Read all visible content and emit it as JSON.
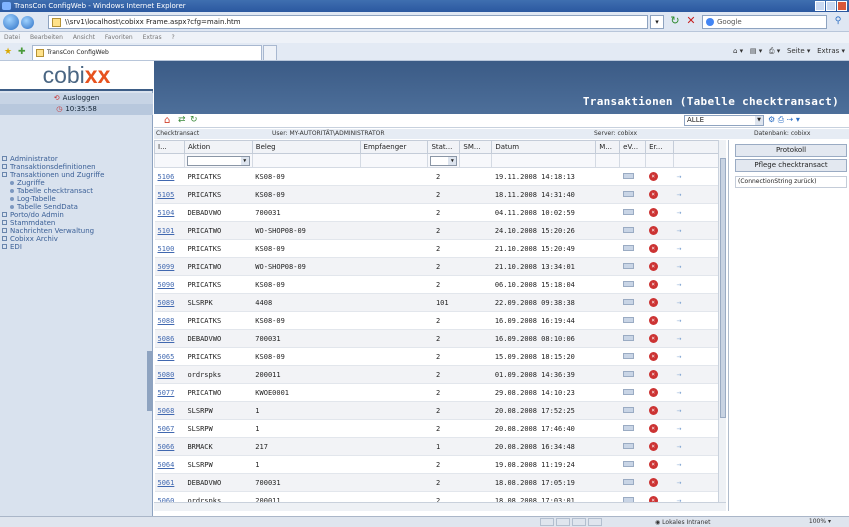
{
  "window": {
    "title": "TransCon ConfigWeb - Windows Internet Explorer"
  },
  "browser": {
    "address": "\\\\srv1\\localhost\\cobixx Frame.aspx?cfg=main.htm",
    "search_placeholder": "Google",
    "menu": [
      "Datei",
      "Bearbeiten",
      "Ansicht",
      "Favoriten",
      "Extras",
      "?"
    ],
    "tab_title": "TransCon ConfigWeb",
    "cmd_page": "Seite",
    "cmd_tools": "Extras"
  },
  "sidebar": {
    "logo_main": "cobi",
    "logo_accent": "xx",
    "logout_label": "Ausloggen",
    "time": "10:35:58",
    "items": [
      {
        "label": "Administrator",
        "level": 0
      },
      {
        "label": "Transaktionsdefinitionen",
        "level": 0
      },
      {
        "label": "Transaktionen und Zugriffe",
        "level": 0
      },
      {
        "label": "Zugriffe",
        "level": 1
      },
      {
        "label": "Tabelle checktransact",
        "level": 1
      },
      {
        "label": "Log-Tabelle",
        "level": 1
      },
      {
        "label": "Tabelle SendData",
        "level": 1
      },
      {
        "label": "Porto/do Admin",
        "level": 0
      },
      {
        "label": "Stammdaten",
        "level": 0
      },
      {
        "label": "Nachrichten Verwaltung",
        "level": 0
      },
      {
        "label": "Cobixx Archiv",
        "level": 0
      },
      {
        "label": "EDI",
        "level": 0
      }
    ]
  },
  "header": {
    "title": "Transaktionen (Tabelle checktransact)",
    "filter_value": "ALLE"
  },
  "info": {
    "left": "Checktransact",
    "middle": "User: MY-AUTORITÄT\\ADMINISTRATOR",
    "server": "Server: cobixx",
    "database": "Datenbank: cobixx"
  },
  "table": {
    "columns": [
      "I...",
      "Aktion",
      "Beleg",
      "Empfaenger",
      "Stat...",
      "SM...",
      "Datum",
      "M...",
      "eV...",
      "Er..."
    ],
    "rows": [
      {
        "id": "5106",
        "aktion": "PRICATKS",
        "beleg": "KS08-09",
        "empfaenger": "",
        "status": "2",
        "datum": "19.11.2008 14:18:13"
      },
      {
        "id": "5105",
        "aktion": "PRICATKS",
        "beleg": "KS08-09",
        "empfaenger": "",
        "status": "2",
        "datum": "18.11.2008 14:31:40"
      },
      {
        "id": "5104",
        "aktion": "DEBADVWO",
        "beleg": "700031",
        "empfaenger": "",
        "status": "2",
        "datum": "04.11.2008 10:02:59"
      },
      {
        "id": "5101",
        "aktion": "PRICATWO",
        "beleg": "WO-SHOP08-09",
        "empfaenger": "",
        "status": "2",
        "datum": "24.10.2008 15:20:26"
      },
      {
        "id": "5100",
        "aktion": "PRICATKS",
        "beleg": "KS08-09",
        "empfaenger": "",
        "status": "2",
        "datum": "21.10.2008 15:20:49"
      },
      {
        "id": "5099",
        "aktion": "PRICATWO",
        "beleg": "WO-SHOP08-09",
        "empfaenger": "",
        "status": "2",
        "datum": "21.10.2008 13:34:01"
      },
      {
        "id": "5090",
        "aktion": "PRICATKS",
        "beleg": "KS08-09",
        "empfaenger": "",
        "status": "2",
        "datum": "06.10.2008 15:18:04"
      },
      {
        "id": "5089",
        "aktion": "SLSRPK",
        "beleg": "4408",
        "empfaenger": "",
        "status": "101",
        "datum": "22.09.2008 09:38:38"
      },
      {
        "id": "5088",
        "aktion": "PRICATKS",
        "beleg": "KS08-09",
        "empfaenger": "",
        "status": "2",
        "datum": "16.09.2008 16:19:44"
      },
      {
        "id": "5086",
        "aktion": "DEBADVWO",
        "beleg": "700031",
        "empfaenger": "",
        "status": "2",
        "datum": "16.09.2008 08:10:06"
      },
      {
        "id": "5065",
        "aktion": "PRICATKS",
        "beleg": "KS08-09",
        "empfaenger": "",
        "status": "2",
        "datum": "15.09.2008 18:15:20"
      },
      {
        "id": "5080",
        "aktion": "ordrspks",
        "beleg": "200011",
        "empfaenger": "",
        "status": "2",
        "datum": "01.09.2008 14:36:39"
      },
      {
        "id": "5077",
        "aktion": "PRICATWO",
        "beleg": "KWOE0001",
        "empfaenger": "",
        "status": "2",
        "datum": "29.08.2008 14:10:23"
      },
      {
        "id": "5068",
        "aktion": "SLSRPW",
        "beleg": "1",
        "empfaenger": "",
        "status": "2",
        "datum": "20.08.2008 17:52:25"
      },
      {
        "id": "5067",
        "aktion": "SLSRPW",
        "beleg": "1",
        "empfaenger": "",
        "status": "2",
        "datum": "20.08.2008 17:46:40"
      },
      {
        "id": "5066",
        "aktion": "BRMACK",
        "beleg": "217",
        "empfaenger": "",
        "status": "1",
        "datum": "20.08.2008 16:34:48"
      },
      {
        "id": "5064",
        "aktion": "SLSRPW",
        "beleg": "1",
        "empfaenger": "",
        "status": "2",
        "datum": "19.08.2008 11:19:24"
      },
      {
        "id": "5061",
        "aktion": "DEBADVWO",
        "beleg": "700031",
        "empfaenger": "",
        "status": "2",
        "datum": "18.08.2008 17:05:19"
      },
      {
        "id": "5060",
        "aktion": "ordrspks",
        "beleg": "200011",
        "empfaenger": "",
        "status": "2",
        "datum": "18.08.2008 17:03:01"
      }
    ]
  },
  "right_panel": {
    "btn_protokoll": "Protokoll",
    "btn_pflege": "Pflege checktransact",
    "connection": "(ConnectionString zurück)"
  },
  "statusbar": {
    "zone": "Lokales Intranet",
    "zoom": "100%"
  }
}
